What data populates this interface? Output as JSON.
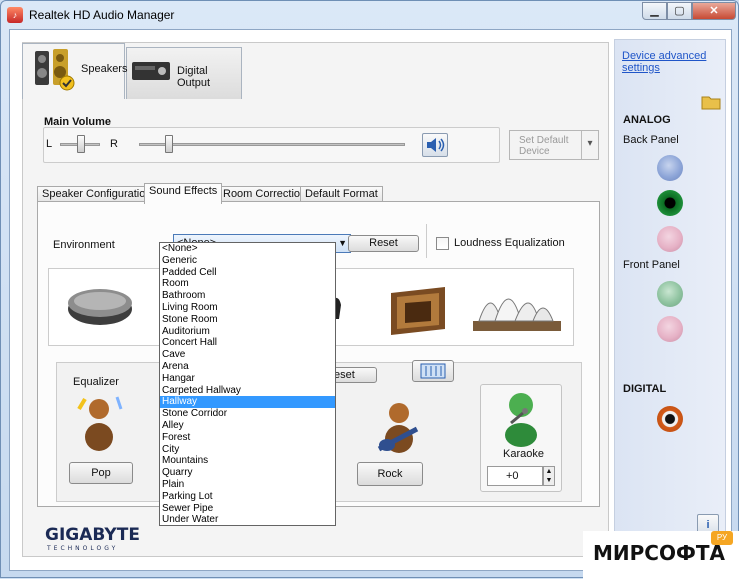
{
  "window": {
    "title": "Realtek HD Audio Manager"
  },
  "device_tabs": [
    {
      "label": "Speakers"
    },
    {
      "label": "Digital Output"
    }
  ],
  "volume": {
    "label": "Main Volume",
    "left_label": "L",
    "right_label": "R",
    "set_default_label": "Set Default Device"
  },
  "subtabs": [
    {
      "label": "Speaker Configuration"
    },
    {
      "label": "Sound Effects"
    },
    {
      "label": "Room Correction"
    },
    {
      "label": "Default Format"
    }
  ],
  "environment": {
    "label": "Environment",
    "selected": "<None>",
    "reset_label": "Reset",
    "loudness_label": "Loudness Equalization",
    "options": [
      "<None>",
      "Generic",
      "Padded Cell",
      "Room",
      "Bathroom",
      "Living Room",
      "Stone Room",
      "Auditorium",
      "Concert Hall",
      "Cave",
      "Arena",
      "Hangar",
      "Carpeted Hallway",
      "Hallway",
      "Stone Corridor",
      "Alley",
      "Forest",
      "City",
      "Mountains",
      "Quarry",
      "Plain",
      "Parking Lot",
      "Sewer Pipe",
      "Under Water"
    ],
    "highlighted": "Hallway"
  },
  "equalizer": {
    "label": "Equalizer",
    "reset_label": "eset",
    "pop_label": "Pop",
    "rock_label": "Rock"
  },
  "karaoke": {
    "label": "Karaoke",
    "value": "+0"
  },
  "side": {
    "link": "Device advanced settings",
    "analog_label": "ANALOG",
    "back_panel_label": "Back Panel",
    "front_panel_label": "Front Panel",
    "digital_label": "DIGITAL"
  },
  "brand": {
    "name": "GIGABYTE",
    "sub": "TECHNOLOGY"
  },
  "watermark": {
    "text": "МИРСОФТА",
    "badge": "РУ"
  },
  "colors": {
    "jack_blue": "#8ea6d8",
    "jack_green": "#0b6b22",
    "jack_pink": "#e6b2c6",
    "jack_orange": "#d35a18",
    "selection": "#3399ff"
  }
}
